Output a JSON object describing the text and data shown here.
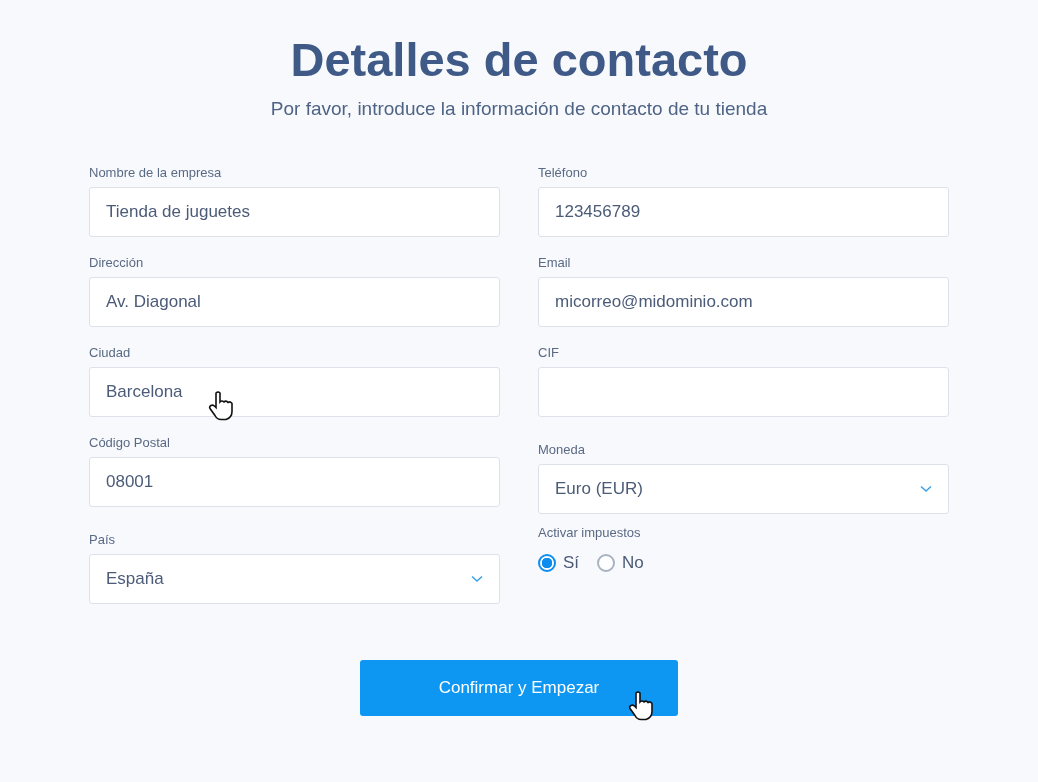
{
  "title": "Detalles de contacto",
  "subtitle": "Por favor, introduce la información de contacto de tu tienda",
  "columns": [
    {
      "fields": [
        {
          "kind": "text",
          "label": "Nombre de la empresa",
          "value": "Tienda de juguetes"
        },
        {
          "kind": "text",
          "label": "Dirección",
          "value": "Av. Diagonal"
        },
        {
          "kind": "text",
          "label": "Ciudad",
          "value": "Barcelona",
          "cursor": true
        },
        {
          "kind": "text",
          "label": "Código Postal",
          "value": "08001"
        },
        {
          "kind": "select",
          "label": "País",
          "value": "España"
        }
      ]
    },
    {
      "fields": [
        {
          "kind": "text",
          "label": "Teléfono",
          "value": "123456789"
        },
        {
          "kind": "text",
          "label": "Email",
          "value": "micorreo@midominio.com"
        },
        {
          "kind": "text",
          "label": "CIF"
        },
        {
          "kind": "select",
          "label": "Moneda",
          "value": "Euro (EUR)"
        },
        {
          "kind": "radio",
          "label": "Activar impuestos",
          "options": [
            {
              "label": "Sí",
              "selected": true
            },
            {
              "label": "No",
              "selected": false
            }
          ]
        }
      ]
    }
  ],
  "button": {
    "label": "Confirmar y Empezar",
    "cursor": true
  }
}
